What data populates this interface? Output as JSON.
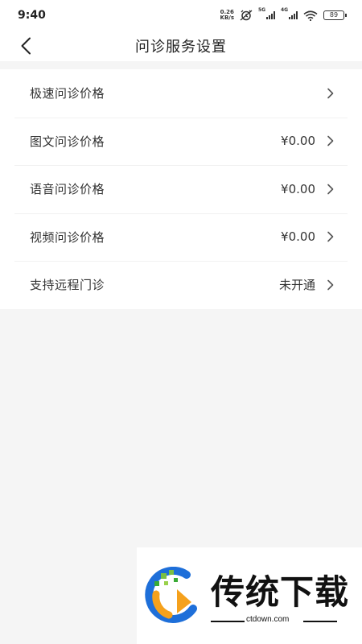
{
  "status_bar": {
    "time": "9:40",
    "net_speed_value": "0.26",
    "net_speed_unit": "KB/s",
    "signal_1_tag": "5G",
    "signal_2_tag": "4G",
    "battery": "89"
  },
  "header": {
    "title": "问诊服务设置",
    "back_icon": "chevron-left-icon"
  },
  "settings": [
    {
      "label": "极速问诊价格",
      "value": ""
    },
    {
      "label": "图文问诊价格",
      "value": "¥0.00"
    },
    {
      "label": "语音问诊价格",
      "value": "¥0.00"
    },
    {
      "label": "视频问诊价格",
      "value": "¥0.00"
    },
    {
      "label": "支持远程门诊",
      "value": "未开通"
    }
  ],
  "watermark": {
    "text": "传统下载",
    "url": "ctdown.com"
  },
  "colors": {
    "background": "#f5f5f5",
    "surface": "#ffffff",
    "text": "#333333",
    "chevron": "#555555"
  }
}
